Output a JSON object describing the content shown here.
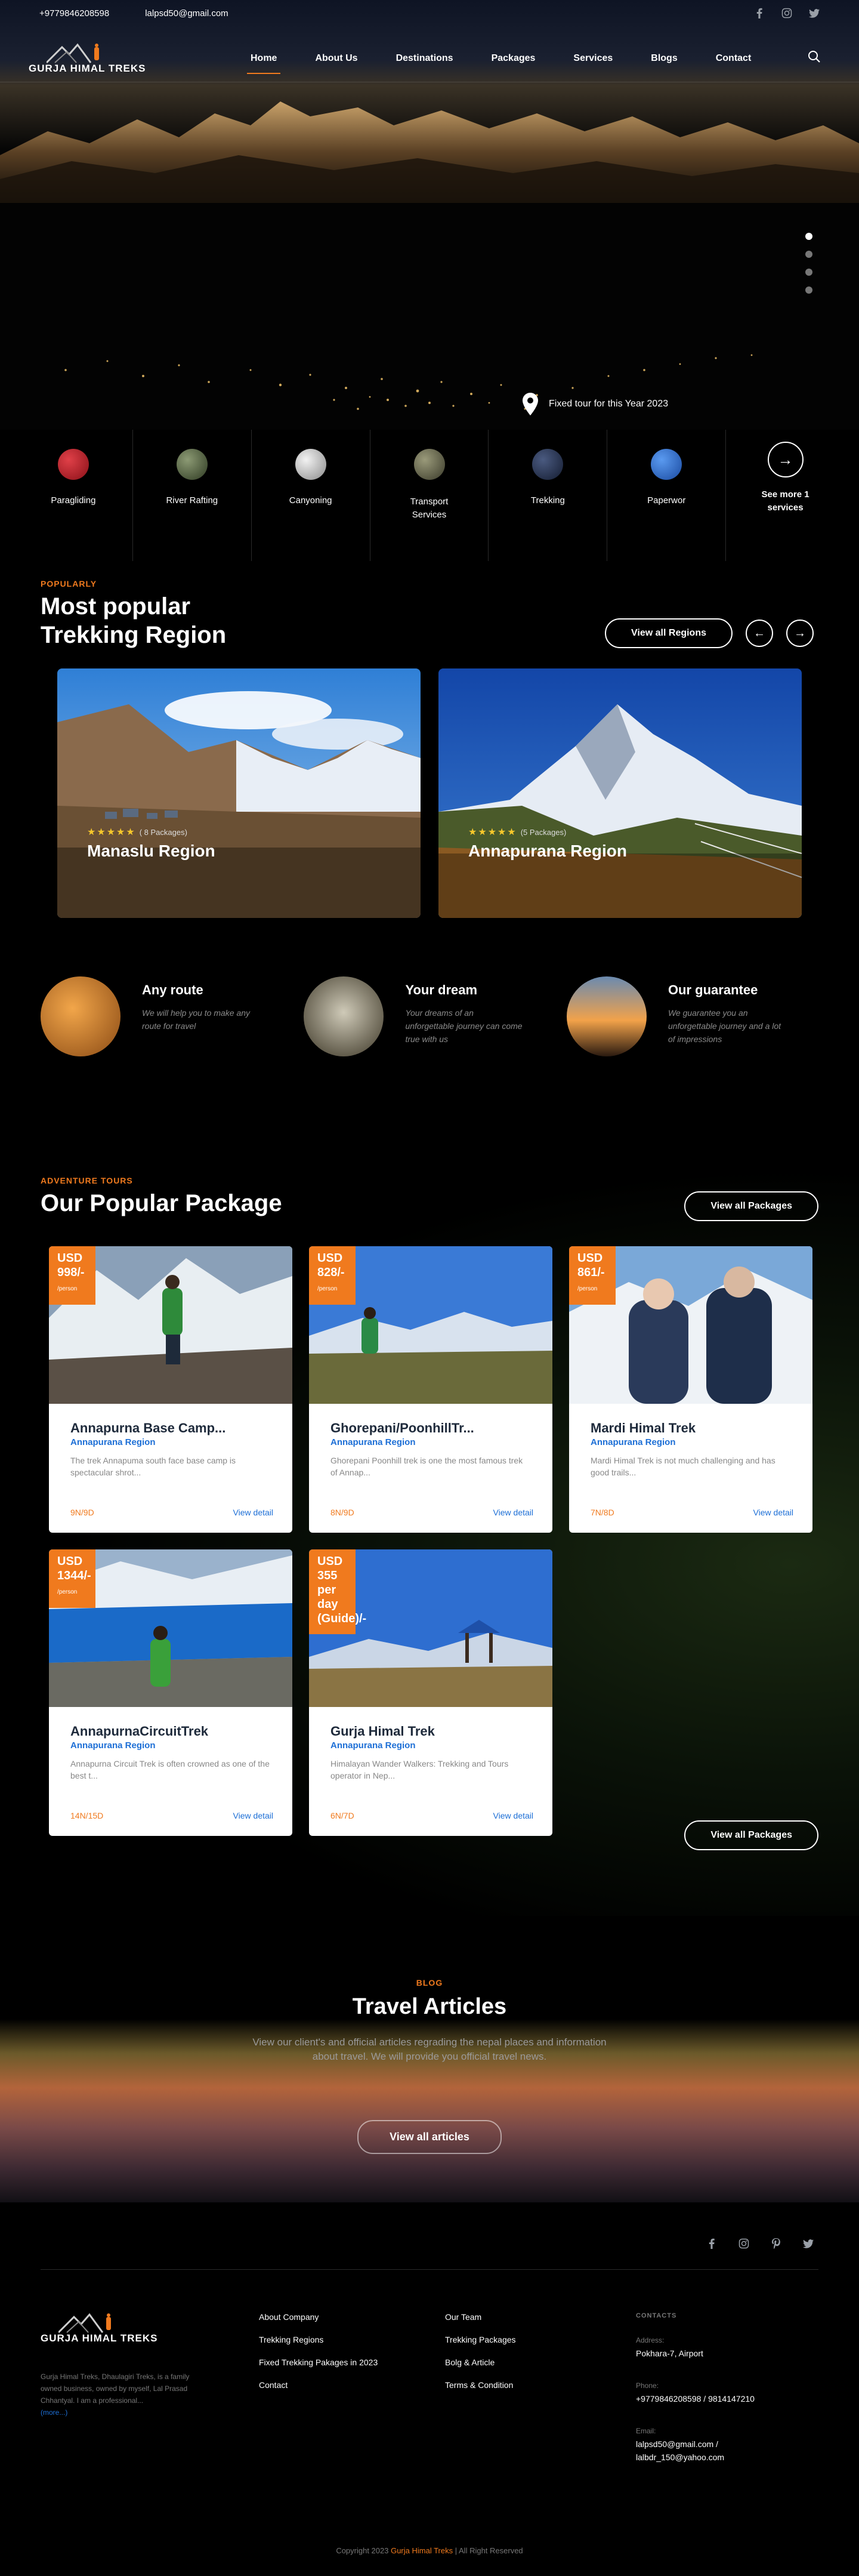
{
  "topbar": {
    "phone": "+9779846208598",
    "email": "lalpsd50@gmail.com",
    "social": [
      "facebook-icon",
      "instagram-icon",
      "twitter-icon"
    ]
  },
  "brand": {
    "name": "GURJA HIMAL TREKS",
    "accent": "#f07a1e",
    "link": "#1d6fd6"
  },
  "nav": {
    "items": [
      {
        "label": "Home",
        "active": true
      },
      {
        "label": "About Us"
      },
      {
        "label": "Destinations"
      },
      {
        "label": "Packages"
      },
      {
        "label": "Services"
      },
      {
        "label": "Blogs"
      },
      {
        "label": "Contact"
      }
    ]
  },
  "hero": {
    "badge": "Fixed tour for this Year 2023",
    "slides": 4,
    "active_slide": 1
  },
  "services": [
    {
      "label": "Paragliding",
      "color": "#c0222c"
    },
    {
      "label": "River Rafting",
      "color": "#5a6a48"
    },
    {
      "label": "Canyoning",
      "color": "#bfbfbf"
    },
    {
      "label": "Transport\nServices",
      "color": "#6b6b55"
    },
    {
      "label": "Trekking",
      "color": "#2a3a5a"
    },
    {
      "label": "Paperwor",
      "color": "#2f6fd0"
    }
  ],
  "services_more": "See more 1\nservices",
  "regions_section": {
    "eyebrow": "POPULARLY",
    "title_line1": "Most popular",
    "title_line2": "Trekking Region",
    "view_all": "View all Regions",
    "items": [
      {
        "name": "Manaslu Region",
        "stars": 5,
        "packages": "( 8 Packages)"
      },
      {
        "name": "Annapurana Region",
        "stars": 5,
        "packages": "(5 Packages)"
      }
    ]
  },
  "features": [
    {
      "title": "Any route",
      "text": "We will help you to make any route for travel"
    },
    {
      "title": "Your dream",
      "text": "Your dreams of an unforgettable journey can come true with us"
    },
    {
      "title": "Our guarantee",
      "text": "We guarantee you an unforgettable journey and a lot of impressions"
    }
  ],
  "packages_section": {
    "eyebrow": "ADVENTURE TOURS",
    "title": "Our Popular Package",
    "view_all": "View all Packages",
    "per_person": "/person",
    "view_detail": "View detail",
    "items": [
      {
        "currency": "USD",
        "price": "998/-",
        "title": "Annapurna Base Camp...",
        "region": "Annapurana Region",
        "desc": "The trek Annapuma south face base camp is spectacular shrot...",
        "days": "9N/9D"
      },
      {
        "currency": "USD",
        "price": "828/-",
        "title": "Ghorepani/PoonhillTr...",
        "region": "Annapurana Region",
        "desc": "Ghorepani Poonhill trek is one the most famous trek of Annap...",
        "days": "8N/9D"
      },
      {
        "currency": "USD",
        "price": "861/-",
        "title": "Mardi Himal Trek",
        "region": "Annapurana Region",
        "desc": "Mardi Himal Trek is not much challenging and has good trails...",
        "days": "7N/8D"
      },
      {
        "currency": "USD",
        "price": "1344/-",
        "title": "AnnapurnaCircuitTrek",
        "region": "Annapurana Region",
        "desc": "Annapurna Circuit Trek is often crowned as one of the best t...",
        "days": "14N/15D"
      },
      {
        "currency": "USD",
        "price": "355 per day (Guide)/-",
        "title": "Gurja Himal Trek",
        "region": "Annapurana Region",
        "desc": "Himalayan Wander Walkers: Trekking and Tours operator in Nep...",
        "days": "6N/7D"
      }
    ]
  },
  "blog": {
    "eyebrow": "BLOG",
    "title": "Travel Articles",
    "text": "View our client's and official articles regrading the nepal places and information about travel. We will provide you official travel news.",
    "button": "View all articles"
  },
  "footer": {
    "social": [
      "facebook-icon",
      "instagram-icon",
      "pinterest-icon",
      "twitter-icon"
    ],
    "about": "Gurja Himal Treks, Dhaulagiri Treks, is a family owned business, owned by myself, Lal Prasad Chhantyal. I am a professional...",
    "more": "(more...)",
    "col1": [
      "About Company",
      "Trekking Regions",
      "Fixed Trekking Pakages in 2023",
      "Contact"
    ],
    "col2": [
      "Our Team",
      "Trekking Packages",
      "Bolg & Article",
      "Terms & Condition"
    ],
    "contacts": {
      "label": "CONTACTS",
      "address_label": "Address:",
      "address": "Pokhara-7, Airport",
      "phone_label": "Phone:",
      "phone": "+9779846208598 / 9814147210",
      "email_label": "Email:",
      "email": "lalpsd50@gmail.com / lalbdr_150@yahoo.com"
    },
    "copyright_pre": "Copyright 2023 ",
    "copyright_brand": "Gurja Himal Treks",
    "copyright_post": " | All Right Reserved"
  }
}
